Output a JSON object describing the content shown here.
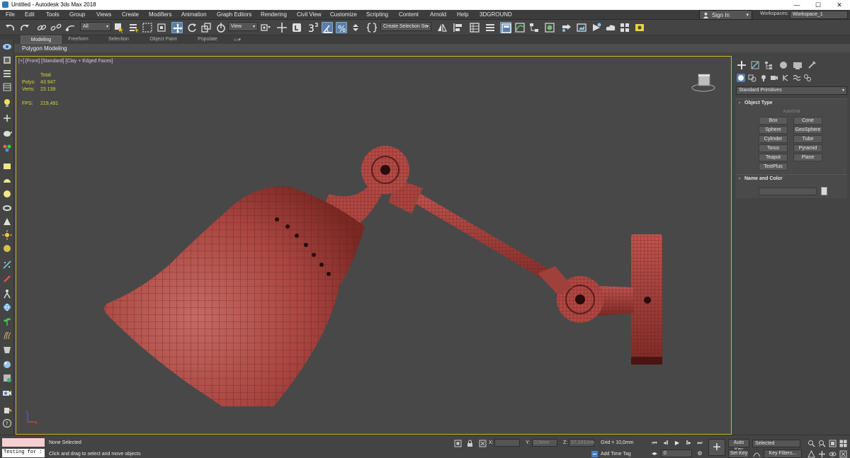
{
  "window": {
    "title": "Untitled - Autodesk 3ds Max 2018",
    "minimize": "—",
    "maximize": "☐",
    "close": "✕"
  },
  "menubar": {
    "items": [
      "File",
      "Edit",
      "Tools",
      "Group",
      "Views",
      "Create",
      "Modifiers",
      "Animation",
      "Graph Editors",
      "Rendering",
      "Civil View",
      "Customize",
      "Scripting",
      "Content",
      "Arnold",
      "Help",
      "3DGROUND"
    ],
    "sign_in": "Sign In",
    "workspaces_label": "Workspaces:",
    "workspace_value": "Workspace_1"
  },
  "toolbar": {
    "selection_filter": "All",
    "reference_coord": "View",
    "selection_set_placeholder": "Create Selection Se",
    "snap_value": "3"
  },
  "ribbon": {
    "tabs": [
      "Modeling",
      "Freeform",
      "Selection",
      "Object Paint",
      "Populate"
    ],
    "active_tab": "Modeling",
    "subpanel_label": "Polygon Modeling"
  },
  "viewport": {
    "label": "[+] [Front] [Standard] [Clay + Edged Faces]",
    "stats": {
      "total_label": "Total",
      "polys_label": "Polys:",
      "polys_value": "43 947",
      "verts_label": "Verts:",
      "verts_value": "23 139",
      "fps_label": "FPS:",
      "fps_value": "219,491"
    },
    "model_color": "#b24a44",
    "border_color": "#d6b21e"
  },
  "command_panel": {
    "category_dropdown": "Standard Primitives",
    "object_type_title": "Object Type",
    "autogrid_label": "AutoGrid",
    "primitives": [
      "Box",
      "Cone",
      "Sphere",
      "GeoSphere",
      "Cylinder",
      "Tube",
      "Torus",
      "Pyramid",
      "Teapot",
      "Plane",
      "TextPlus"
    ],
    "name_color_title": "Name and Color",
    "rollout_sign": "-"
  },
  "statusbar": {
    "maxscript_text": "Testing for :",
    "selection_status": "None Selected",
    "prompt": "Click and drag to select and move objects",
    "x_label": "X:",
    "y_label": "Y:",
    "y_value": "0,0mm",
    "z_label": "Z:",
    "z_value": "37,241mm",
    "grid": "Grid = 10,0mm",
    "add_time_tag": "Add Time Tag",
    "frame_value": "0",
    "auto_key": "Auto Key",
    "set_key": "Set Key",
    "selected_dropdown": "Selected",
    "key_filters": "Key Filters..."
  }
}
